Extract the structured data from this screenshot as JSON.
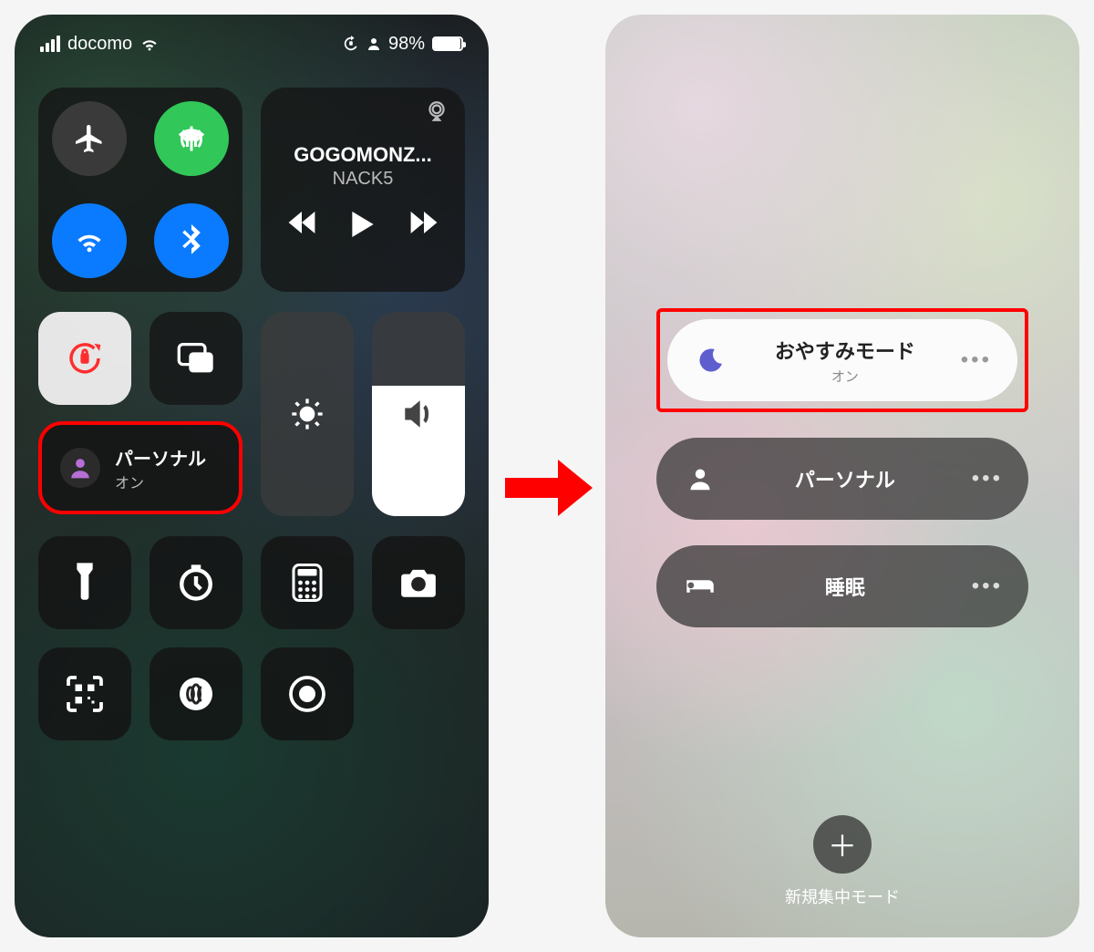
{
  "status": {
    "carrier": "docomo",
    "battery_pct": "98%"
  },
  "cc": {
    "media_title": "GOGOMONZ...",
    "media_subtitle": "NACK5",
    "focus": {
      "name": "パーソナル",
      "state": "オン"
    }
  },
  "right": {
    "items": [
      {
        "icon": "moon",
        "title": "おやすみモード",
        "subtitle": "オン",
        "selected": true,
        "outlined": true
      },
      {
        "icon": "person",
        "title": "パーソナル",
        "subtitle": "",
        "selected": false,
        "outlined": false
      },
      {
        "icon": "bed",
        "title": "睡眠",
        "subtitle": "",
        "selected": false,
        "outlined": false
      }
    ],
    "new_label": "新規集中モード"
  }
}
